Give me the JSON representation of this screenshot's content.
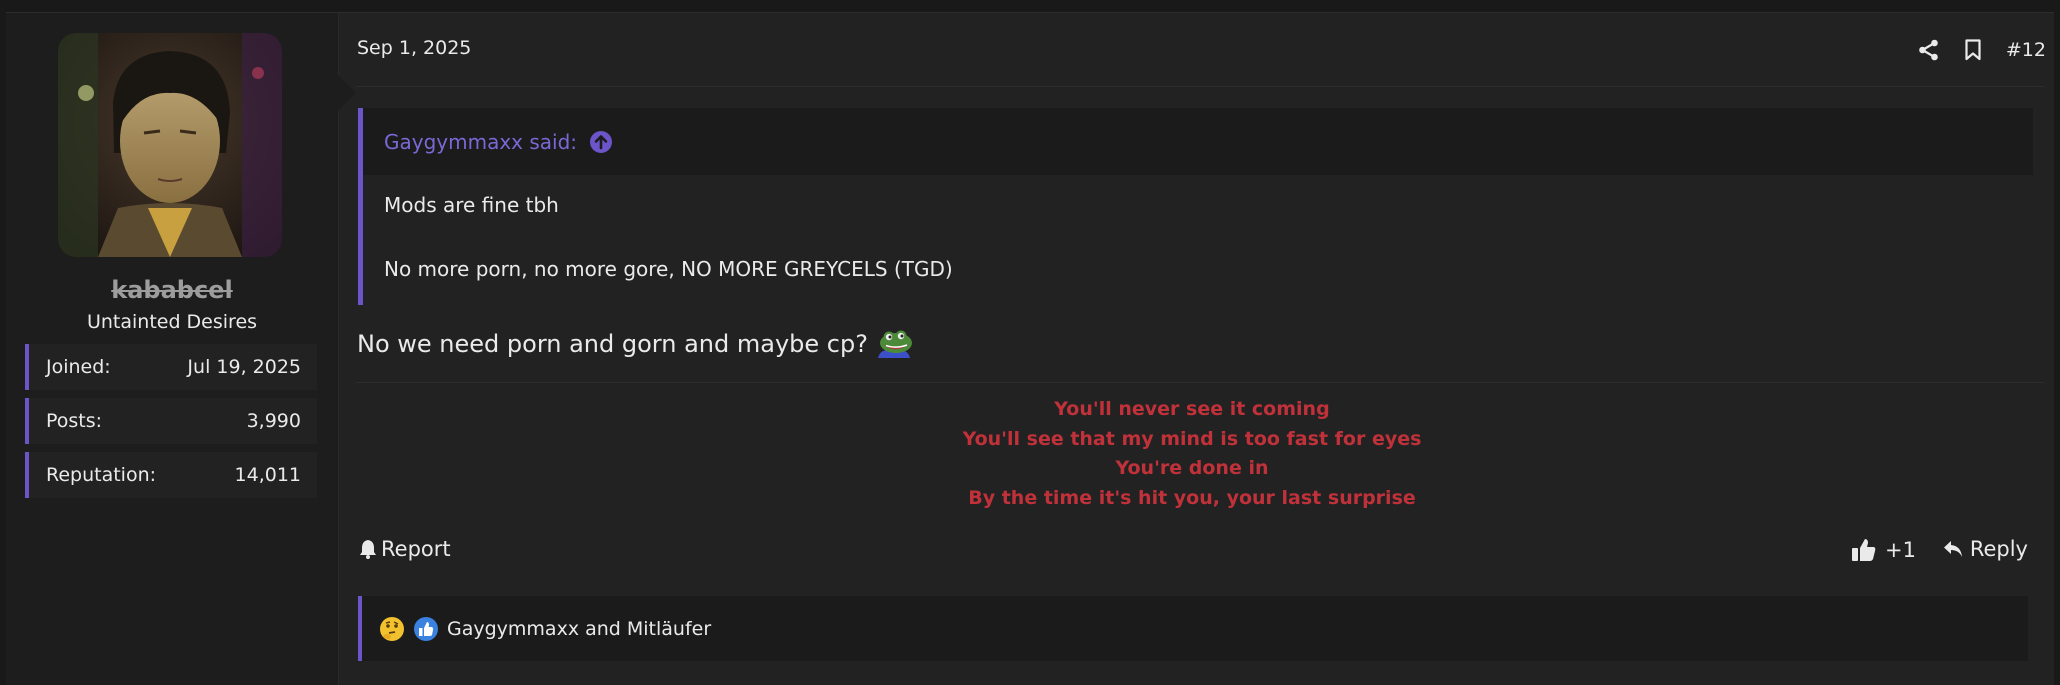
{
  "post": {
    "date": "Sep 1, 2025",
    "number": "#12",
    "message": "No we need porn and gorn and maybe cp?",
    "signature_lines": [
      "You'll never see it coming",
      "You'll see that my mind is too fast for eyes",
      "You're done in",
      "By the time it's hit you, your last surprise"
    ]
  },
  "user": {
    "name": "kababcel",
    "title": "Untainted Desires",
    "stats": [
      {
        "label": "Joined:",
        "value": "Jul 19, 2025"
      },
      {
        "label": "Posts:",
        "value": "3,990"
      },
      {
        "label": "Reputation:",
        "value": "14,011"
      }
    ]
  },
  "quote": {
    "author": "Gaygymmaxx said:",
    "line1": "Mods are fine tbh",
    "line2": "No more porn, no more gore, NO MORE GREYCELS (TGD)"
  },
  "actions": {
    "report": "Report",
    "like_count": "+1",
    "reply": "Reply"
  },
  "reactions": {
    "text": "Gaygymmaxx and Mitläufer"
  },
  "colors": {
    "accent": "#6b55c8",
    "signature": "#c0313a",
    "link": "#7a68d6"
  },
  "icons": [
    "share-icon",
    "bookmark-icon",
    "arrow-up-circle-icon",
    "bell-icon",
    "thumbs-up-icon",
    "reply-icon",
    "pepe-emoji-icon",
    "thinking-emoji-icon",
    "like-reaction-icon"
  ]
}
